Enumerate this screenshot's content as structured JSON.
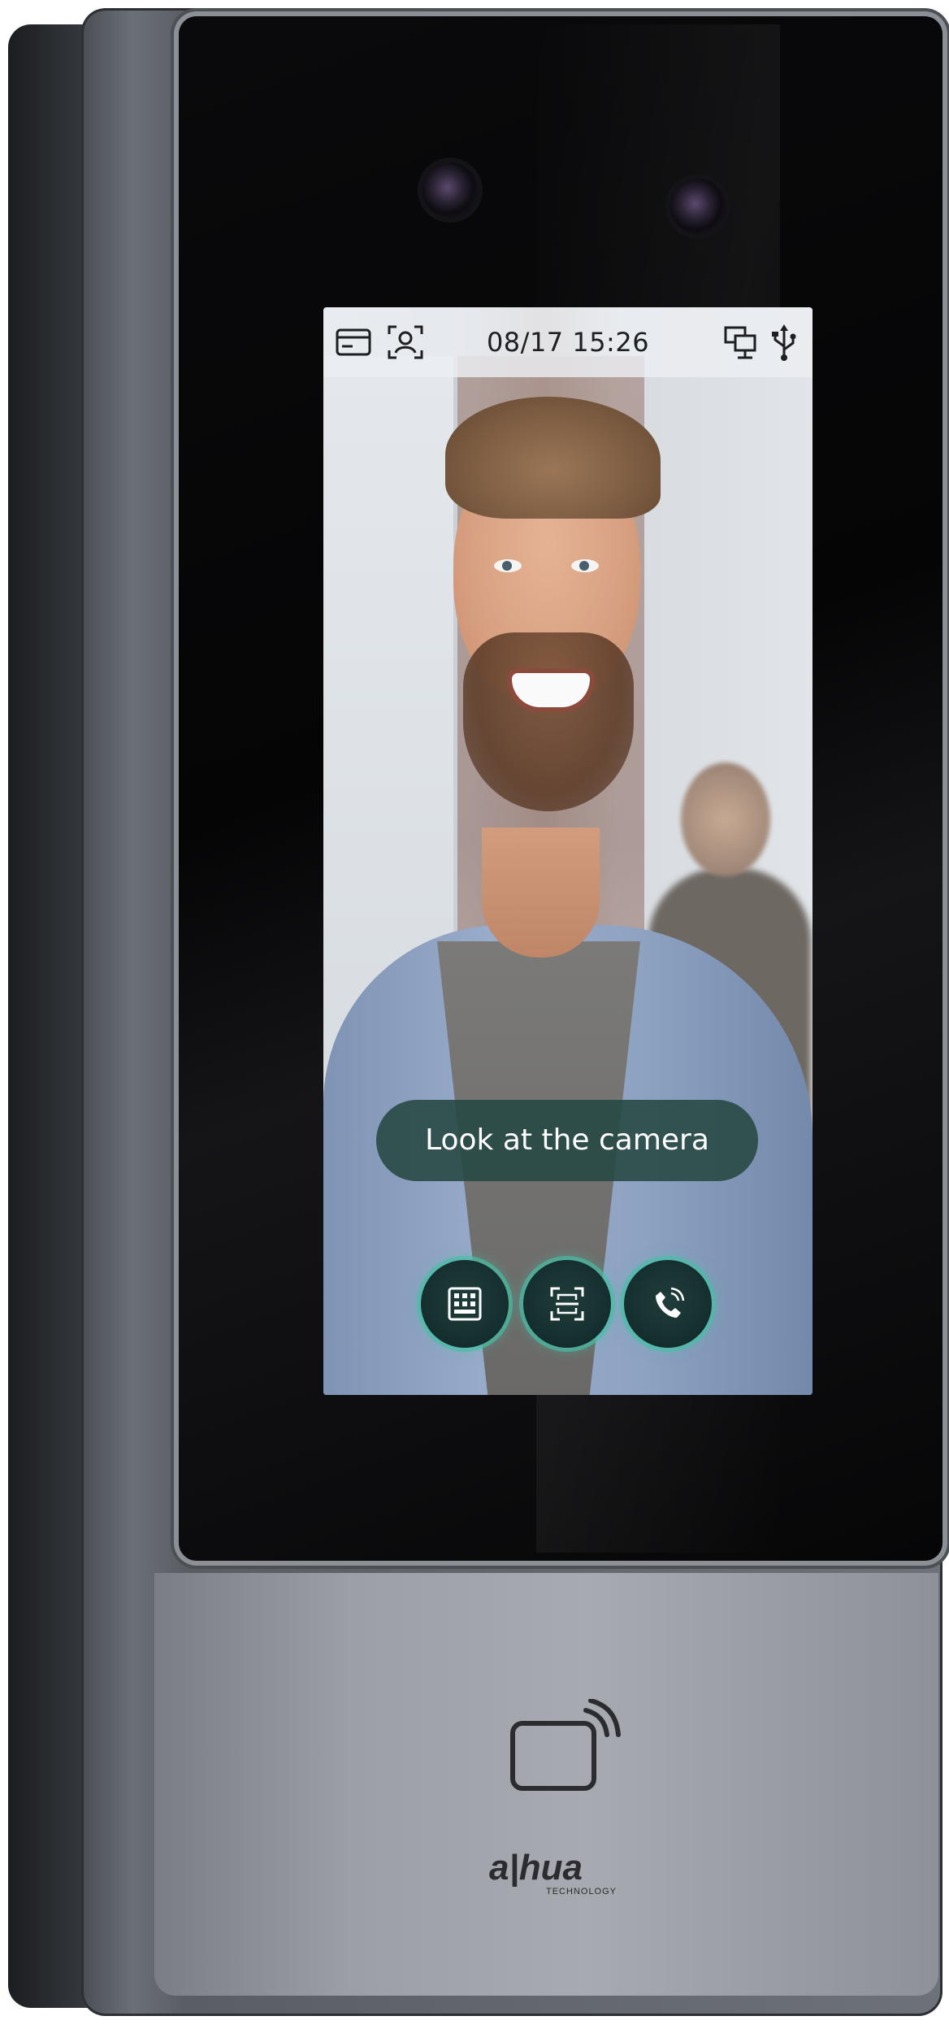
{
  "device": {
    "brand": "alhua",
    "brand_sub": "TECHNOLOGY"
  },
  "screen": {
    "status_bar": {
      "time": "08/17 15:26",
      "left_icons": [
        "card-icon",
        "face-scan-icon"
      ],
      "right_icons": [
        "network-icon",
        "usb-icon"
      ]
    },
    "prompt": "Look at the camera",
    "actions": [
      {
        "icon": "keypad-icon"
      },
      {
        "icon": "qr-scan-icon"
      },
      {
        "icon": "call-icon"
      }
    ],
    "accent_color": "#3fc4a5"
  },
  "panel": {
    "icon": "card-reader-icon"
  }
}
